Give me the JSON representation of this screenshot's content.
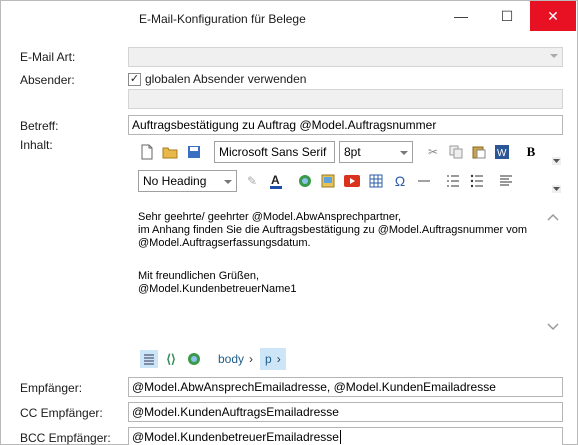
{
  "window": {
    "title": "E-Mail-Konfiguration für Belege",
    "minimize": "—",
    "maximize": "☐",
    "close": "✕"
  },
  "labels": {
    "emailart": "E-Mail Art:",
    "absender": "Absender:",
    "betreff": "Betreff:",
    "inhalt": "Inhalt:",
    "empfaenger": "Empfänger:",
    "cc": "CC Empfänger:",
    "bcc": "BCC Empfänger:"
  },
  "absender": {
    "checkbox_label": "globalen Absender verwenden",
    "checked": true
  },
  "fields": {
    "emailart": "",
    "absender_value": "",
    "betreff": "Auftragsbestätigung zu Auftrag @Model.Auftragsnummer",
    "empfaenger": "@Model.AbwAnsprechEmailadresse, @Model.KundenEmailadresse",
    "cc": "@Model.KundenAuftragsEmailadresse",
    "bcc": "@Model.KundenbetreuerEmailadresse"
  },
  "toolbar": {
    "font": "Microsoft Sans Serif",
    "size": "8pt",
    "heading": "No Heading",
    "bold": "B",
    "omega": "Ω"
  },
  "editor": {
    "line1": "Sehr geehrte/ geehrter @Model.AbwAnsprechpartner,",
    "line2": "im Anhang finden Sie die Auftragsbestätigung zu @Model.Auftragsnummer vom",
    "line3": "@Model.Auftragserfassungsdatum.",
    "line4": "Mit freundlichen Grüßen,",
    "line5": "@Model.KundenbetreuerName1"
  },
  "breadcrumb": {
    "body": "body",
    "p": "p"
  },
  "icons": [
    "new-document-icon",
    "open-folder-icon",
    "save-icon",
    "cut-icon",
    "copy-icon",
    "paste-icon",
    "word-icon",
    "bold-icon",
    "clear-format-icon",
    "font-color-icon",
    "link-icon",
    "image-icon",
    "video-icon",
    "table-icon",
    "special-char-icon",
    "horizontal-line-icon",
    "numbered-list-icon",
    "bullet-list-icon",
    "align-icon",
    "design-view-icon",
    "source-view-icon",
    "preview-icon"
  ],
  "colors": {
    "close_bg": "#e81123",
    "breadcrumb": "#20608a",
    "field_border": "#b5b5b5"
  }
}
